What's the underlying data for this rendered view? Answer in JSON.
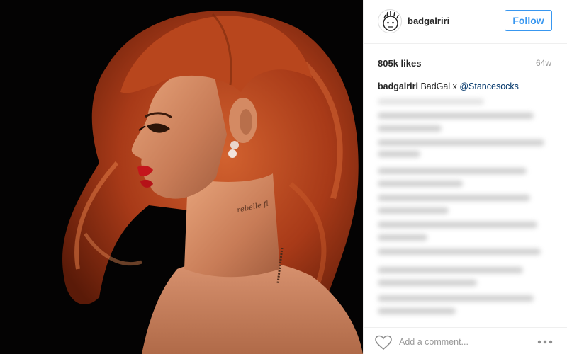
{
  "post": {
    "image_alt": "Portrait photo"
  },
  "header": {
    "username": "badgalriri",
    "follow_label": "Follow",
    "avatar_icon": "cartoon-face-avatar"
  },
  "stats": {
    "likes": "805k likes",
    "age": "64w"
  },
  "caption": {
    "username": "badgalriri",
    "text": "BadGal x ",
    "mention": "@Stancesocks"
  },
  "footer": {
    "comment_placeholder": "Add a comment...",
    "like_icon": "heart-icon",
    "more_icon": "more-options-icon"
  },
  "colors": {
    "accent": "#3897f0",
    "text": "#262626",
    "muted": "#999999",
    "hair": "#b5441f"
  }
}
